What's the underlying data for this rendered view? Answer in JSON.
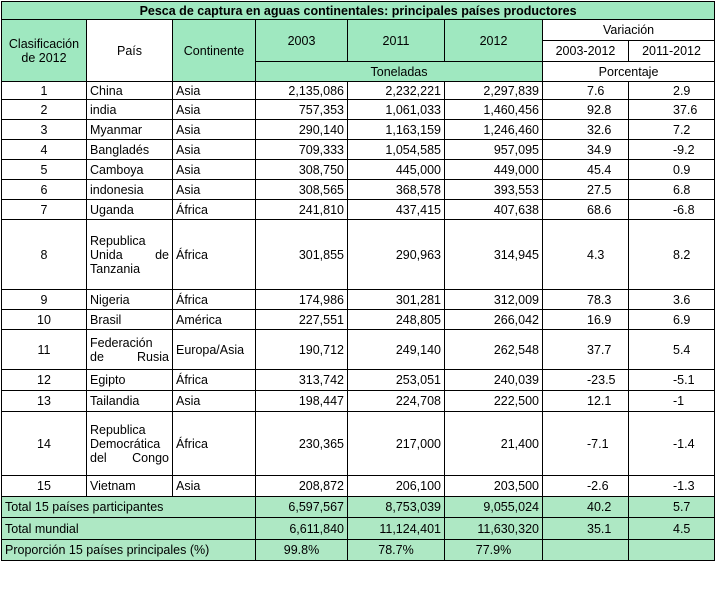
{
  "title": "Pesca de captura en aguas continentales: principales países productores",
  "headers": {
    "rank": "Clasificación de 2012",
    "country": "País",
    "continent": "Continente",
    "y2003": "2003",
    "y2011": "2011",
    "y2012": "2012",
    "variation": "Variación",
    "var_a": "2003-2012",
    "var_b": "2011-2012",
    "tons": "Toneladas",
    "percent": "Porcentaje"
  },
  "rows": [
    {
      "rank": "1",
      "country": "China",
      "continent": "Asia",
      "v2003": "2,135,086",
      "v2011": "2,232,221",
      "v2012": "2,297,839",
      "va": "7.6",
      "vb": "2.9"
    },
    {
      "rank": "2",
      "country": "india",
      "continent": "Asia",
      "v2003": "757,353",
      "v2011": "1,061,033",
      "v2012": "1,460,456",
      "va": "92.8",
      "vb": "37.6"
    },
    {
      "rank": "3",
      "country": "Myanmar",
      "continent": "Asia",
      "v2003": "290,140",
      "v2011": "1,163,159",
      "v2012": "1,246,460",
      "va": "32.6",
      "vb": "7.2"
    },
    {
      "rank": "4",
      "country": "Bangladés",
      "continent": "Asia",
      "v2003": "709,333",
      "v2011": "1,054,585",
      "v2012": "957,095",
      "va": "34.9",
      "vb": "-9.2"
    },
    {
      "rank": "5",
      "country": "Camboya",
      "continent": "Asia",
      "v2003": "308,750",
      "v2011": "445,000",
      "v2012": "449,000",
      "va": "45.4",
      "vb": "0.9"
    },
    {
      "rank": "6",
      "country": "indonesia",
      "continent": "Asia",
      "v2003": "308,565",
      "v2011": "368,578",
      "v2012": "393,553",
      "va": "27.5",
      "vb": "6.8"
    },
    {
      "rank": "7",
      "country": "Uganda",
      "continent": "África",
      "v2003": "241,810",
      "v2011": "437,415",
      "v2012": "407,638",
      "va": "68.6",
      "vb": "-6.8"
    },
    {
      "rank": "8",
      "country": "Republica Unida de Tanzania",
      "continent": "África",
      "v2003": "301,855",
      "v2011": "290,963",
      "v2012": "314,945",
      "va": "4.3",
      "vb": "8.2"
    },
    {
      "rank": "9",
      "country": "Nigeria",
      "continent": "África",
      "v2003": "174,986",
      "v2011": "301,281",
      "v2012": "312,009",
      "va": "78.3",
      "vb": "3.6"
    },
    {
      "rank": "10",
      "country": "Brasil",
      "continent": "América",
      "v2003": "227,551",
      "v2011": "248,805",
      "v2012": "266,042",
      "va": "16.9",
      "vb": "6.9"
    },
    {
      "rank": "11",
      "country": "Federación de Rusia",
      "continent": "Europa/Asia",
      "v2003": "190,712",
      "v2011": "249,140",
      "v2012": "262,548",
      "va": "37.7",
      "vb": "5.4"
    },
    {
      "rank": "12",
      "country": "Egipto",
      "continent": "África",
      "v2003": "313,742",
      "v2011": "253,051",
      "v2012": "240,039",
      "va": "-23.5",
      "vb": "-5.1"
    },
    {
      "rank": "13",
      "country": "Tailandia",
      "continent": "Asia",
      "v2003": "198,447",
      "v2011": "224,708",
      "v2012": "222,500",
      "va": "12.1",
      "vb": "-1"
    },
    {
      "rank": "14",
      "country": "Republica Democrática del Congo",
      "continent": "África",
      "v2003": "230,365",
      "v2011": "217,000",
      "v2012": "21,400",
      "va": "-7.1",
      "vb": "-1.4"
    },
    {
      "rank": "15",
      "country": "Vietnam",
      "continent": "Asia",
      "v2003": "208,872",
      "v2011": "206,100",
      "v2012": "203,500",
      "va": "-2.6",
      "vb": "-1.3"
    }
  ],
  "totals": [
    {
      "label": "Total 15 países participantes",
      "v2003": "6,597,567",
      "v2011": "8,753,039",
      "v2012": "9,055,024",
      "va": "40.2",
      "vb": "5.7"
    },
    {
      "label": "Total mundial",
      "v2003": "6,611,840",
      "v2011": "11,124,401",
      "v2012": "11,630,320",
      "va": "35.1",
      "vb": "4.5"
    },
    {
      "label": "Proporción 15 países principales (%)",
      "v2003": "99.8%",
      "v2011": "78.7%",
      "v2012": "77.9%",
      "va": "",
      "vb": ""
    }
  ]
}
